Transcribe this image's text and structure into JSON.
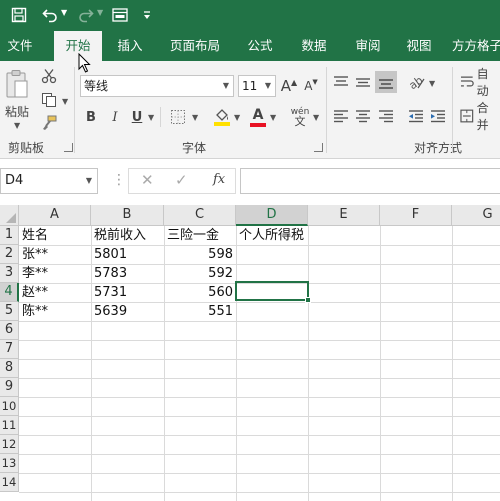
{
  "quick_access": {
    "save_icon": "save-icon",
    "undo_icon": "undo-icon",
    "redo_icon": "redo-icon",
    "form_icon": "form-icon",
    "customize_icon": "customize-icon"
  },
  "tabs": [
    {
      "label": "文件",
      "active": false
    },
    {
      "label": "开始",
      "active": true
    },
    {
      "label": "插入",
      "active": false
    },
    {
      "label": "页面布局",
      "active": false
    },
    {
      "label": "公式",
      "active": false
    },
    {
      "label": "数据",
      "active": false
    },
    {
      "label": "审阅",
      "active": false
    },
    {
      "label": "视图",
      "active": false
    },
    {
      "label": "方方格子",
      "active": false
    }
  ],
  "ribbon": {
    "clipboard": {
      "paste_label": "粘贴",
      "group_label": "剪贴板"
    },
    "font": {
      "font_name": "等线",
      "font_size": "11",
      "bold": "B",
      "italic": "I",
      "underline": "U",
      "increase_size": "A",
      "decrease_size": "A",
      "phonetic": "wén",
      "font_color": "#e81123",
      "fill_color": "#ffe000",
      "group_label": "字体"
    },
    "alignment": {
      "auto_wrap": "自动",
      "merge": "合并",
      "group_label": "对齐方式"
    }
  },
  "formula_bar": {
    "name_box": "D4",
    "cancel": "✕",
    "enter": "✓",
    "fx": "fx",
    "value": ""
  },
  "sheet": {
    "columns": [
      "A",
      "B",
      "C",
      "D",
      "E",
      "F",
      "G"
    ],
    "selected_column": "D",
    "rows": [
      "1",
      "2",
      "3",
      "4",
      "5",
      "6",
      "7",
      "8",
      "9",
      "10",
      "11",
      "12",
      "13",
      "14"
    ],
    "selected_row": "4",
    "selected_cell": "D4",
    "headers": {
      "A": "姓名",
      "B": "税前收入",
      "C": "三险一金",
      "D": "个人所得税"
    },
    "data": [
      {
        "name": "张**",
        "income": "5801",
        "insurance": "598",
        "tax": ""
      },
      {
        "name": "李**",
        "income": "5783",
        "insurance": "592",
        "tax": ""
      },
      {
        "name": "赵**",
        "income": "5731",
        "insurance": "560",
        "tax": ""
      },
      {
        "name": "陈**",
        "income": "5639",
        "insurance": "551",
        "tax": ""
      }
    ]
  },
  "colors": {
    "accent": "#217346",
    "ribbon_bg": "#f3f3f3"
  }
}
